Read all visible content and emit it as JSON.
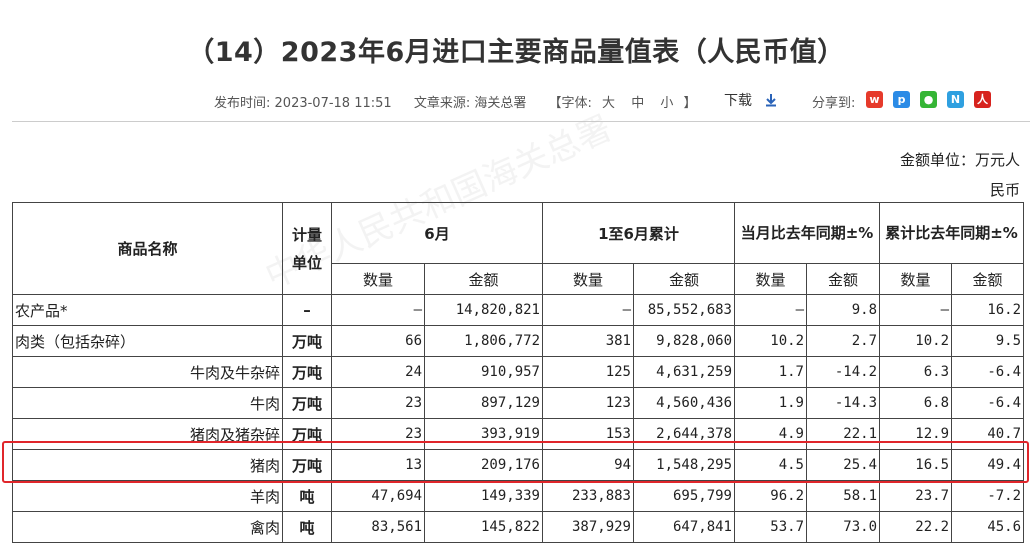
{
  "title": "（14）2023年6月进口主要商品量值表（人民币值）",
  "meta": {
    "publish_label": "发布时间:",
    "publish_time": "2023-07-18 11:51",
    "source_label": "文章来源:",
    "source": "海关总署",
    "font_label_open": "【字体:",
    "font_large": "大",
    "font_medium": "中",
    "font_small": "小",
    "font_label_close": "】",
    "download": "下载",
    "share_label": "分享到:"
  },
  "share_icons": [
    "weibo-icon",
    "qzone-icon",
    "wechat-icon",
    "renren-icon",
    "people-icon"
  ],
  "unit_line1": "金额单位：万元人",
  "unit_line2": "民币",
  "table": {
    "h_name": "商品名称",
    "h_unit": "计量单位",
    "h_june": "6月",
    "h_cum": "1至6月累计",
    "h_yoy_month": "当月比去年同期±%",
    "h_yoy_cum": "累计比去年同期±%",
    "h_qty": "数量",
    "h_amt": "金额",
    "rows": [
      {
        "name": "农产品*",
        "unit": "–",
        "qty": "–",
        "amt": "14,820,821",
        "cqty": "–",
        "camt": "85,552,683",
        "mq": "–",
        "ma": "9.8",
        "cq": "–",
        "ca": "16.2"
      },
      {
        "name": "肉类（包括杂碎）",
        "unit": "万吨",
        "qty": "66",
        "amt": "1,806,772",
        "cqty": "381",
        "camt": "9,828,060",
        "mq": "10.2",
        "ma": "2.7",
        "cq": "10.2",
        "ca": "9.5"
      },
      {
        "name": "牛肉及牛杂碎",
        "unit": "万吨",
        "qty": "24",
        "amt": "910,957",
        "cqty": "125",
        "camt": "4,631,259",
        "mq": "1.7",
        "ma": "-14.2",
        "cq": "6.3",
        "ca": "-6.4"
      },
      {
        "name": "牛肉",
        "unit": "万吨",
        "qty": "23",
        "amt": "897,129",
        "cqty": "123",
        "camt": "4,560,436",
        "mq": "1.9",
        "ma": "-14.3",
        "cq": "6.8",
        "ca": "-6.4"
      },
      {
        "name": "猪肉及猪杂碎",
        "unit": "万吨",
        "qty": "23",
        "amt": "393,919",
        "cqty": "153",
        "camt": "2,644,378",
        "mq": "4.9",
        "ma": "22.1",
        "cq": "12.9",
        "ca": "40.7"
      },
      {
        "name": "猪肉",
        "unit": "万吨",
        "qty": "13",
        "amt": "209,176",
        "cqty": "94",
        "camt": "1,548,295",
        "mq": "4.5",
        "ma": "25.4",
        "cq": "16.5",
        "ca": "49.4"
      },
      {
        "name": "羊肉",
        "unit": "吨",
        "qty": "47,694",
        "amt": "149,339",
        "cqty": "233,883",
        "camt": "695,799",
        "mq": "96.2",
        "ma": "58.1",
        "cq": "23.7",
        "ca": "-7.2"
      },
      {
        "name": "禽肉",
        "unit": "吨",
        "qty": "83,561",
        "amt": "145,822",
        "cqty": "387,929",
        "camt": "647,841",
        "mq": "53.7",
        "ma": "73.0",
        "cq": "22.2",
        "ca": "45.6"
      }
    ]
  },
  "colors": {
    "highlight": "#e0262b",
    "download_arrow": "#2a63b8"
  }
}
